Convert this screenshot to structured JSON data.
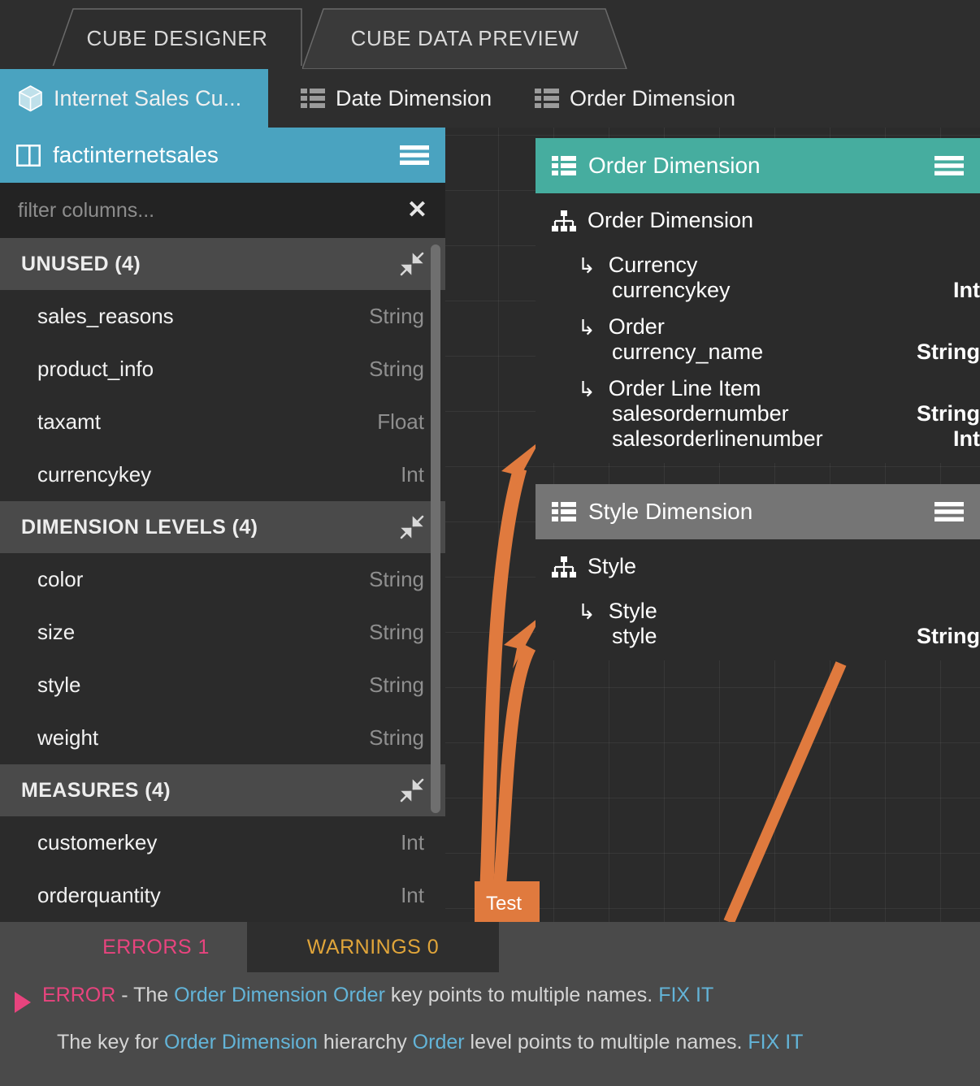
{
  "app": {
    "accent_cyan": "#4aa3c0",
    "accent_teal": "#46ad9f",
    "accent_grey": "#757575",
    "link_orange": "#e07a3e",
    "error_pink": "#e8447e",
    "warning_amber": "#e0a53a",
    "link_blue": "#63b4d8"
  },
  "topbar": {
    "tabs": [
      {
        "label": "CUBE DESIGNER",
        "active": true
      },
      {
        "label": "CUBE DATA PREVIEW",
        "active": false
      }
    ]
  },
  "dimension_tabs": [
    {
      "label": "Internet Sales Cu...",
      "icon": "cube-icon",
      "active": true
    },
    {
      "label": "Date Dimension",
      "icon": "list-icon",
      "active": false
    },
    {
      "label": "Order Dimension",
      "icon": "list-icon",
      "active": false
    }
  ],
  "table_panel": {
    "title": "factinternetsales",
    "title_icon": "table-columns-icon",
    "menu_icon": "hamburger-icon",
    "filter": {
      "placeholder": "filter columns...",
      "value": "",
      "clear_icon": "close-icon"
    },
    "sections": [
      {
        "label": "UNUSED (4)",
        "collapse_icon": "collapse-icon",
        "columns": [
          {
            "name": "sales_reasons",
            "type": "String"
          },
          {
            "name": "product_info",
            "type": "String"
          },
          {
            "name": "taxamt",
            "type": "Float"
          },
          {
            "name": "currencykey",
            "type": "Int"
          }
        ]
      },
      {
        "label": "DIMENSION LEVELS (4)",
        "collapse_icon": "collapse-icon",
        "columns": [
          {
            "name": "color",
            "type": "String"
          },
          {
            "name": "size",
            "type": "String"
          },
          {
            "name": "style",
            "type": "String"
          },
          {
            "name": "weight",
            "type": "String"
          }
        ]
      },
      {
        "label": "MEASURES (4)",
        "collapse_icon": "collapse-icon",
        "columns": [
          {
            "name": "customerkey",
            "type": "Int"
          },
          {
            "name": "orderquantity",
            "type": "Int"
          }
        ]
      }
    ]
  },
  "canvas": {
    "node_label": "Test",
    "order_card": {
      "title": "Order Dimension",
      "title_icon": "list-icon",
      "menu_icon": "hamburger-icon",
      "root": {
        "label": "Order Dimension",
        "icon": "hierarchy-icon"
      },
      "levels": [
        {
          "label": "Currency",
          "attributes": [
            {
              "name": "currencykey",
              "type": "Int"
            }
          ]
        },
        {
          "label": "Order",
          "attributes": [
            {
              "name": "currency_name",
              "type": "String"
            }
          ]
        },
        {
          "label": "Order Line Item",
          "attributes": [
            {
              "name": "salesordernumber",
              "type": "String"
            },
            {
              "name": "salesorderlinenumber",
              "type": "Int"
            }
          ]
        }
      ]
    },
    "style_card": {
      "title": "Style Dimension",
      "title_icon": "list-icon",
      "menu_icon": "hamburger-icon",
      "root": {
        "label": "Style",
        "icon": "hierarchy-icon"
      },
      "levels": [
        {
          "label": "Style",
          "attributes": [
            {
              "name": "style",
              "type": "String"
            }
          ]
        }
      ]
    }
  },
  "dock": {
    "tabs": [
      {
        "label": "ERRORS 1",
        "active": true
      },
      {
        "label": "WARNINGS 0",
        "active": false
      }
    ],
    "error": {
      "severity": "ERROR",
      "dash": " - ",
      "text_a": "The ",
      "subject": "Order Dimension Order",
      "text_b": " key points to multiple names. ",
      "fix": "FIX IT",
      "detail_a": "The key for ",
      "detail_link1": "Order Dimension",
      "detail_b": " hierarchy ",
      "detail_link2": "Order",
      "detail_c": " level points to multiple names. ",
      "detail_fix": "FIX IT"
    }
  }
}
